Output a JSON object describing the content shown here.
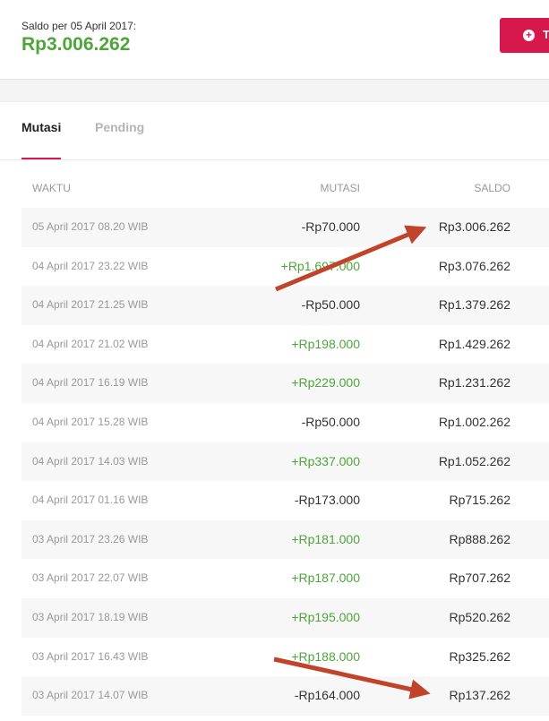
{
  "header": {
    "saldo_label": "Saldo per 05 April 2017:",
    "saldo_value": "Rp3.006.262",
    "top_button_label": "T"
  },
  "tabs": [
    {
      "label": "Mutasi",
      "active": true
    },
    {
      "label": "Pending",
      "active": false
    }
  ],
  "table": {
    "headers": {
      "waktu": "WAKTU",
      "mutasi": "MUTASI",
      "saldo": "SALDO"
    },
    "rows": [
      {
        "waktu": "05 April 2017 08.20 WIB",
        "mutasi": "-Rp70.000",
        "type": "neg",
        "saldo": "Rp3.006.262"
      },
      {
        "waktu": "04 April 2017 23.22 WIB",
        "mutasi": "+Rp1.697.000",
        "type": "pos",
        "saldo": "Rp3.076.262"
      },
      {
        "waktu": "04 April 2017 21.25 WIB",
        "mutasi": "-Rp50.000",
        "type": "neg",
        "saldo": "Rp1.379.262"
      },
      {
        "waktu": "04 April 2017 21.02 WIB",
        "mutasi": "+Rp198.000",
        "type": "pos",
        "saldo": "Rp1.429.262"
      },
      {
        "waktu": "04 April 2017 16.19 WIB",
        "mutasi": "+Rp229.000",
        "type": "pos",
        "saldo": "Rp1.231.262"
      },
      {
        "waktu": "04 April 2017 15.28 WIB",
        "mutasi": "-Rp50.000",
        "type": "neg",
        "saldo": "Rp1.002.262"
      },
      {
        "waktu": "04 April 2017 14.03 WIB",
        "mutasi": "+Rp337.000",
        "type": "pos",
        "saldo": "Rp1.052.262"
      },
      {
        "waktu": "04 April 2017 01.16 WIB",
        "mutasi": "-Rp173.000",
        "type": "neg",
        "saldo": "Rp715.262"
      },
      {
        "waktu": "03 April 2017 23.26 WIB",
        "mutasi": "+Rp181.000",
        "type": "pos",
        "saldo": "Rp888.262"
      },
      {
        "waktu": "03 April 2017 22.07 WIB",
        "mutasi": "+Rp187.000",
        "type": "pos",
        "saldo": "Rp707.262"
      },
      {
        "waktu": "03 April 2017 18.19 WIB",
        "mutasi": "+Rp195.000",
        "type": "pos",
        "saldo": "Rp520.262"
      },
      {
        "waktu": "03 April 2017 16.43 WIB",
        "mutasi": "+Rp188.000",
        "type": "pos",
        "saldo": "Rp325.262"
      },
      {
        "waktu": "03 April 2017 14.07 WIB",
        "mutasi": "-Rp164.000",
        "type": "neg",
        "saldo": "Rp137.262"
      }
    ]
  },
  "colors": {
    "accent": "#d6184d",
    "positive": "#4ea53a",
    "annotation_arrow": "#c0432a"
  }
}
